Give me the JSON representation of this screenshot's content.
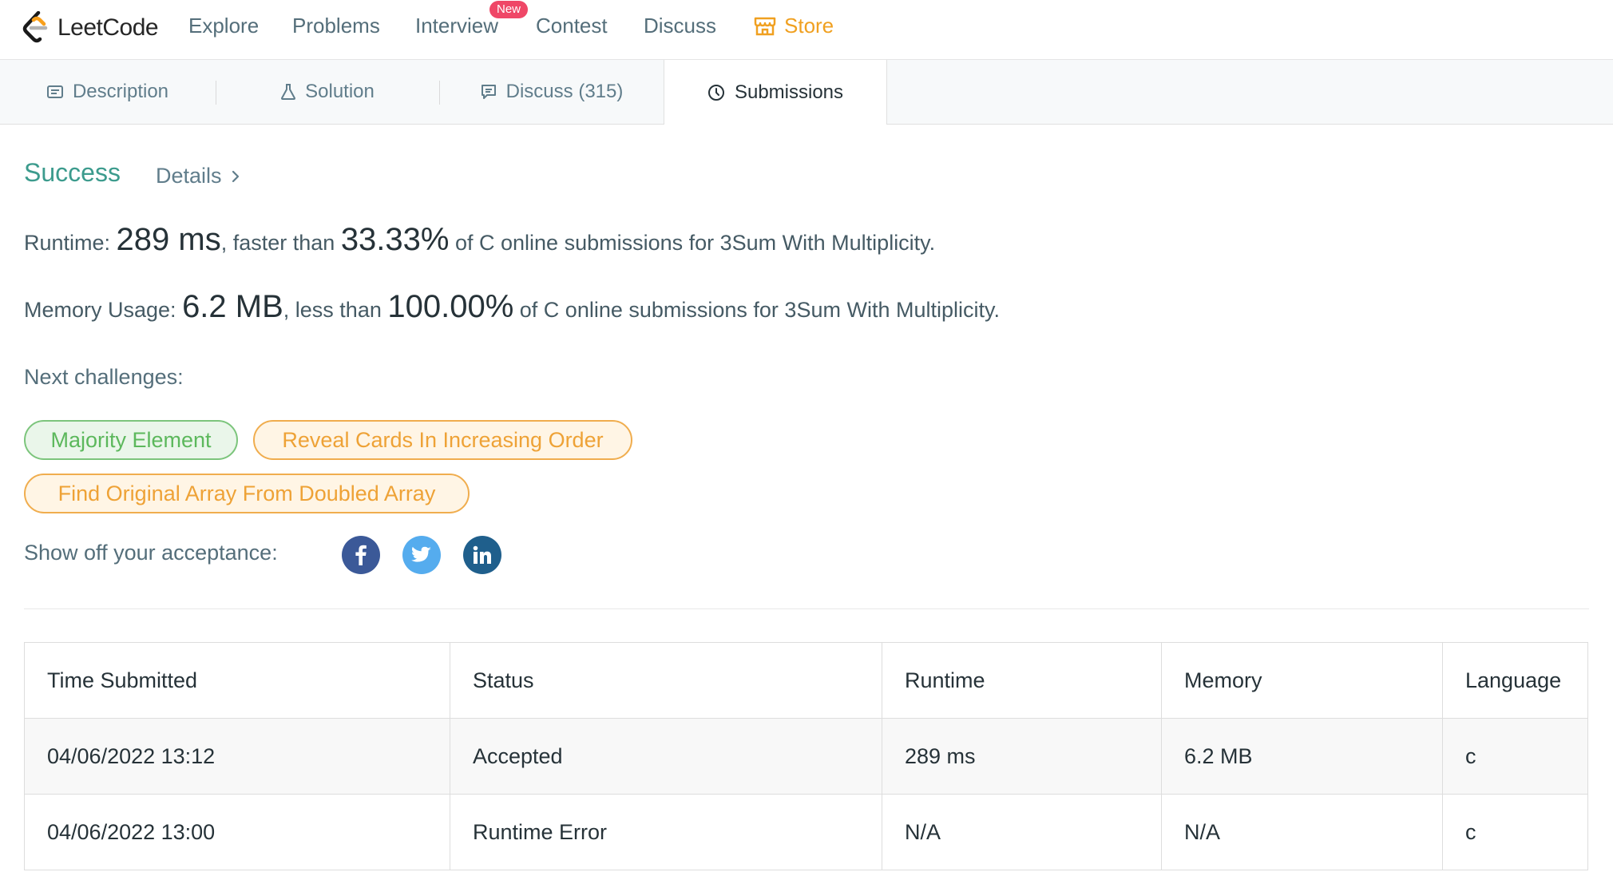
{
  "nav": {
    "logo_text": "LeetCode",
    "items": [
      "Explore",
      "Problems",
      "Interview",
      "Contest",
      "Discuss"
    ],
    "badge": "New",
    "store": "Store"
  },
  "tabs": [
    "Description",
    "Solution",
    "Discuss (315)",
    "Submissions"
  ],
  "result": {
    "status": "Success",
    "details": "Details",
    "runtime_label": "Runtime: ",
    "runtime_value": "289 ms",
    "runtime_mid": ", faster than ",
    "runtime_pct": "33.33%",
    "runtime_tail": " of C online submissions for 3Sum With Multiplicity.",
    "memory_label": "Memory Usage: ",
    "memory_value": "6.2 MB",
    "memory_mid": ", less than ",
    "memory_pct": "100.00%",
    "memory_tail": " of C online submissions for 3Sum With Multiplicity."
  },
  "next": {
    "label": "Next challenges:",
    "challenges": [
      {
        "title": "Majority Element",
        "difficulty": "easy"
      },
      {
        "title": "Reveal Cards In Increasing Order",
        "difficulty": "medium"
      },
      {
        "title": "Find Original Array From Doubled Array",
        "difficulty": "medium"
      }
    ]
  },
  "share": {
    "label": "Show off your acceptance:",
    "icons": [
      "facebook-icon",
      "twitter-icon",
      "linkedin-icon"
    ]
  },
  "table": {
    "headers": [
      "Time Submitted",
      "Status",
      "Runtime",
      "Memory",
      "Language"
    ],
    "rows": [
      [
        "04/06/2022 13:12",
        "Accepted",
        "289 ms",
        "6.2 MB",
        "c"
      ],
      [
        "04/06/2022 13:00",
        "Runtime Error",
        "N/A",
        "N/A",
        "c"
      ]
    ]
  },
  "colors": {
    "success": "#3c9b8d",
    "error": "#c62828",
    "easy": "#5cb85c",
    "medium": "#eea236",
    "store": "#f0a020",
    "badge": "#ef4767"
  }
}
